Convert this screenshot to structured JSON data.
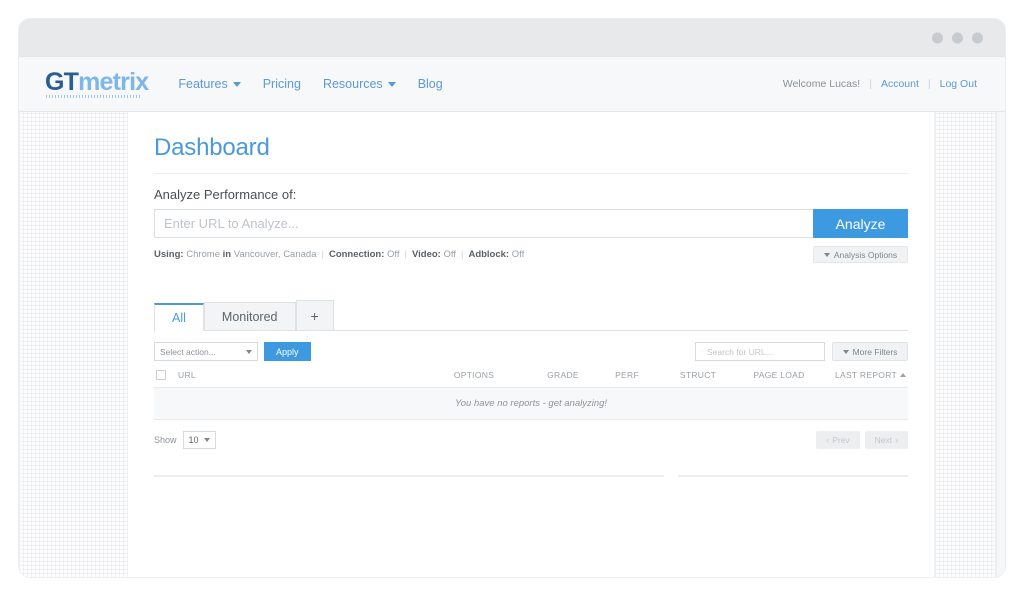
{
  "window": {
    "dots_count": 3
  },
  "header": {
    "logo": {
      "part1": "GT",
      "part2": "metrix"
    },
    "nav": [
      {
        "label": "Features",
        "has_caret": true
      },
      {
        "label": "Pricing",
        "has_caret": false
      },
      {
        "label": "Resources",
        "has_caret": true
      },
      {
        "label": "Blog",
        "has_caret": false
      }
    ],
    "welcome": "Welcome Lucas!",
    "sep1": "|",
    "account_label": "Account",
    "sep2": "|",
    "logout_label": "Log Out"
  },
  "main": {
    "page_title": "Dashboard",
    "analyze_label": "Analyze Performance of:",
    "url_placeholder": "Enter URL to Analyze...",
    "url_value": "",
    "analyze_button": "Analyze",
    "analysis_options_label": "Analysis Options",
    "using": {
      "using_label": "Using:",
      "browser": "Chrome",
      "in_label": "in",
      "location": "Vancouver, Canada",
      "connection_label": "Connection:",
      "connection_value": "Off",
      "video_label": "Video:",
      "video_value": "Off",
      "adblock_label": "Adblock:",
      "adblock_value": "Off"
    },
    "tabs": [
      {
        "label": "All",
        "active": true
      },
      {
        "label": "Monitored",
        "active": false
      },
      {
        "label": "+",
        "active": false
      }
    ],
    "toolbar": {
      "select_action_value": "Select action...",
      "apply_label": "Apply",
      "search_placeholder": "Search for URL...",
      "search_value": "",
      "more_filters_label": "More Filters"
    },
    "table": {
      "columns": [
        "URL",
        "OPTIONS",
        "GRADE",
        "PERF",
        "STRUCT",
        "PAGE LOAD",
        "LAST REPORT"
      ],
      "sorted_column": "LAST REPORT",
      "sort_direction": "asc",
      "rows": [],
      "empty_message": "You have no reports - get analyzing!"
    },
    "footer": {
      "show_label": "Show",
      "show_value": "10",
      "prev_label": "Prev",
      "next_label": "Next"
    }
  },
  "colors": {
    "accent_blue": "#3d9ae0",
    "title_blue": "#4a9ada",
    "logo_dark": "#2a5d96",
    "logo_light": "#7db6e8",
    "header_bg": "#f7f8f9",
    "titlebar_bg": "#e7e9eb"
  }
}
